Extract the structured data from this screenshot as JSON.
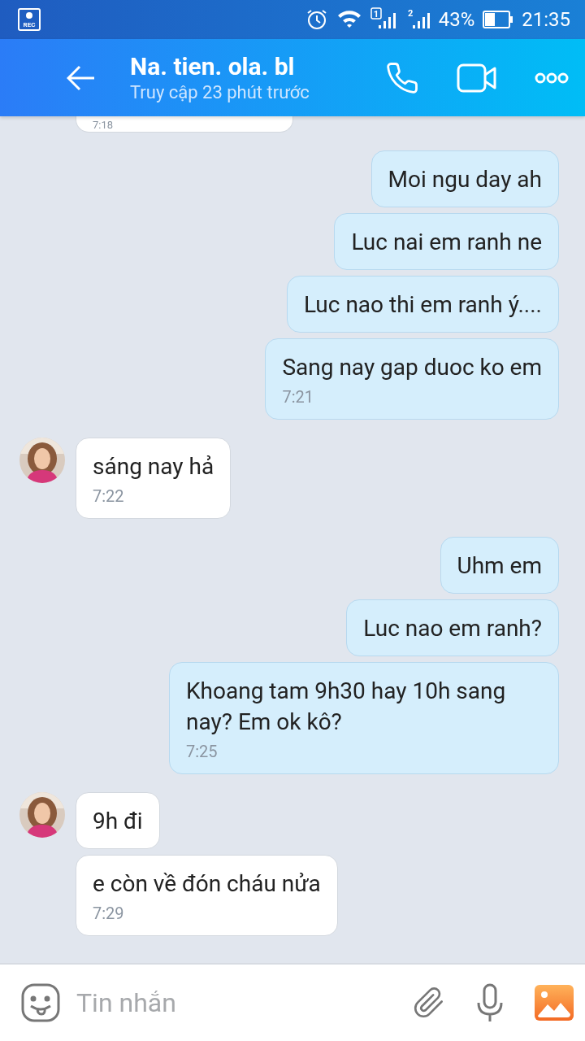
{
  "status_bar": {
    "battery_text": "43%",
    "time": "21:35",
    "sim_1": "1",
    "sim_2": "2",
    "rec": "REC"
  },
  "header": {
    "title": "Na. tien. ola. bl",
    "subtitle": "Truy cập 23 phút trước"
  },
  "messages": [
    {
      "kind": "cut",
      "outgoing": false,
      "time": "7:18"
    },
    {
      "kind": "bubble",
      "outgoing": true,
      "text": "Moi ngu day ah"
    },
    {
      "kind": "bubble",
      "outgoing": true,
      "text": "Luc nai em ranh ne"
    },
    {
      "kind": "bubble",
      "outgoing": true,
      "text": "Luc nao thi em ranh ý...."
    },
    {
      "kind": "bubble",
      "outgoing": true,
      "text": "Sang nay gap duoc ko em",
      "time": "7:21"
    },
    {
      "kind": "bubble",
      "outgoing": false,
      "avatar": true,
      "text": "sáng nay hả",
      "time": "7:22"
    },
    {
      "kind": "bubble",
      "outgoing": true,
      "text": "Uhm em"
    },
    {
      "kind": "bubble",
      "outgoing": true,
      "text": "Luc nao em ranh?"
    },
    {
      "kind": "bubble",
      "outgoing": true,
      "text": "Khoang tam 9h30 hay 10h sang nay? Em ok kô?",
      "time": "7:25"
    },
    {
      "kind": "bubble",
      "outgoing": false,
      "avatar": true,
      "text": "9h đi"
    },
    {
      "kind": "bubble",
      "outgoing": false,
      "avatar": false,
      "text": "e còn về đón cháu nửa",
      "time": "7:29"
    }
  ],
  "composer": {
    "placeholder": "Tin nhắn"
  }
}
